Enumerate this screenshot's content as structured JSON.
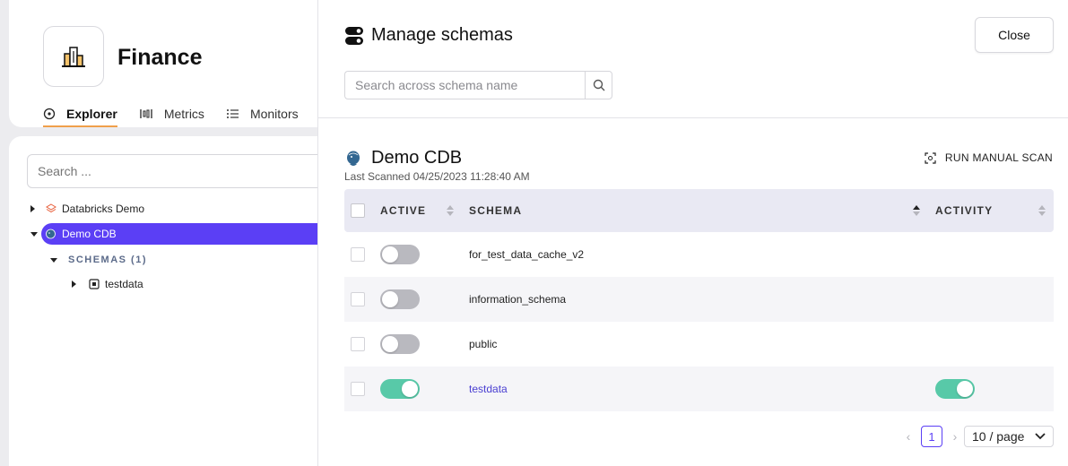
{
  "app": {
    "title": "Finance",
    "nav": [
      {
        "label": "Explorer",
        "icon": "target-icon",
        "active": true
      },
      {
        "label": "Metrics",
        "icon": "metrics-icon"
      },
      {
        "label": "Monitors",
        "icon": "list-icon"
      }
    ]
  },
  "tree": {
    "search_placeholder": "Search ...",
    "items": [
      {
        "label": "Databricks Demo",
        "icon": "databricks-icon"
      },
      {
        "label": "Demo CDB",
        "icon": "postgres-icon",
        "selected": true
      },
      {
        "label": "SCHEMAS (1)"
      },
      {
        "label": "testdata",
        "icon": "schema-icon"
      }
    ]
  },
  "drawer": {
    "title": "Manage schemas",
    "close_label": "Close",
    "search_placeholder": "Search across schema name",
    "db_name": "Demo CDB",
    "last_scanned": "Last Scanned 04/25/2023 11:28:40 AM",
    "scan_label": "RUN MANUAL SCAN",
    "columns": {
      "active": "ACTIVE",
      "schema": "SCHEMA",
      "activity": "ACTIVITY"
    },
    "rows": [
      {
        "schema": "for_test_data_cache_v2",
        "active": false,
        "activity": false
      },
      {
        "schema": "information_schema",
        "active": false,
        "activity": false
      },
      {
        "schema": "public",
        "active": false,
        "activity": false
      },
      {
        "schema": "testdata",
        "active": true,
        "activity": true
      }
    ],
    "pager": {
      "current_page": "1",
      "page_size": "10 / page",
      "prev": "‹",
      "next": "›"
    }
  },
  "colors": {
    "accent": "#5b3ff5",
    "toggle_on": "#58c9a8",
    "nav_underline": "#f0a04b"
  }
}
